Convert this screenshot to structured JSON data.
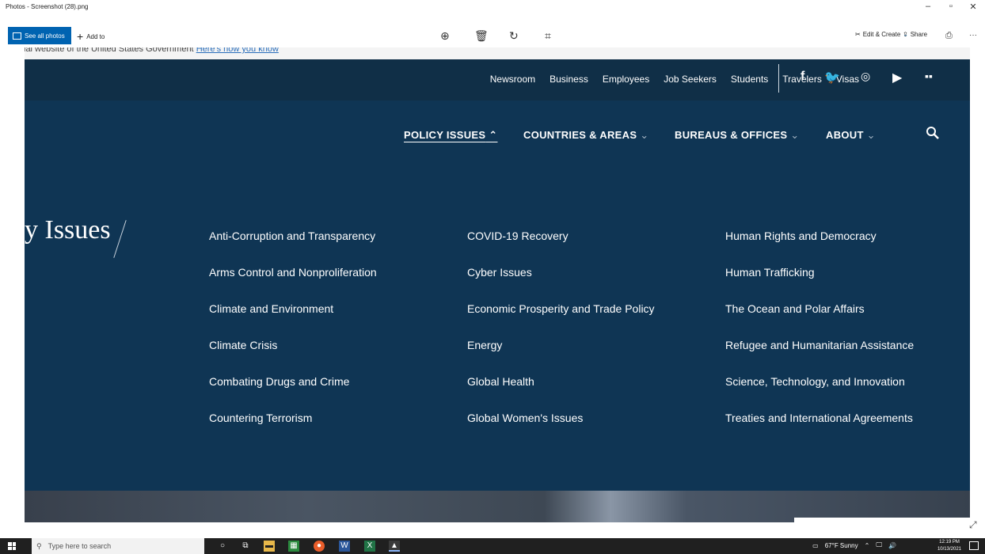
{
  "window": {
    "title": "Photos - Screenshot (28).png",
    "minimize": "–",
    "maximize": "▫",
    "close": "✕"
  },
  "toolbar": {
    "see_all_photos": "See all photos",
    "add_to": "Add to",
    "edit_create": "Edit & Create",
    "share": "Share",
    "more": "···"
  },
  "site": {
    "gov_banner_text": "ial website of the United States Government",
    "gov_banner_link": "Here's how you know",
    "utility_nav": [
      "Newsroom",
      "Business",
      "Employees",
      "Job Seekers",
      "Students",
      "Travelers",
      "Visas"
    ],
    "main_nav": [
      {
        "label": "POLICY ISSUES",
        "active": true
      },
      {
        "label": "COUNTRIES & AREAS",
        "active": false
      },
      {
        "label": "BUREAUS & OFFICES",
        "active": false
      },
      {
        "label": "ABOUT",
        "active": false
      }
    ],
    "section_title": "y Issues",
    "columns": [
      [
        "Anti-Corruption and Transparency",
        "Arms Control and Nonproliferation",
        "Climate and Environment",
        "Climate Crisis",
        "Combating Drugs and Crime",
        "Countering Terrorism"
      ],
      [
        "COVID-19 Recovery",
        "Cyber Issues",
        "Economic Prosperity and Trade Policy",
        "Energy",
        "Global Health",
        "Global Women's Issues"
      ],
      [
        "Human Rights and Democracy",
        "Human Trafficking",
        "The Ocean and Polar Affairs",
        "Refugee and Humanitarian Assistance",
        "Science, Technology, and Innovation",
        "Treaties and International Agreements"
      ]
    ]
  },
  "taskbar": {
    "search_placeholder": "Type here to search",
    "weather": "67°F  Sunny",
    "time": "12:19 PM",
    "date": "10/13/2021"
  },
  "colors": {
    "topbar": "#102f47",
    "nav_bg": "#0f3554",
    "accent_blue": "#0063b1"
  }
}
